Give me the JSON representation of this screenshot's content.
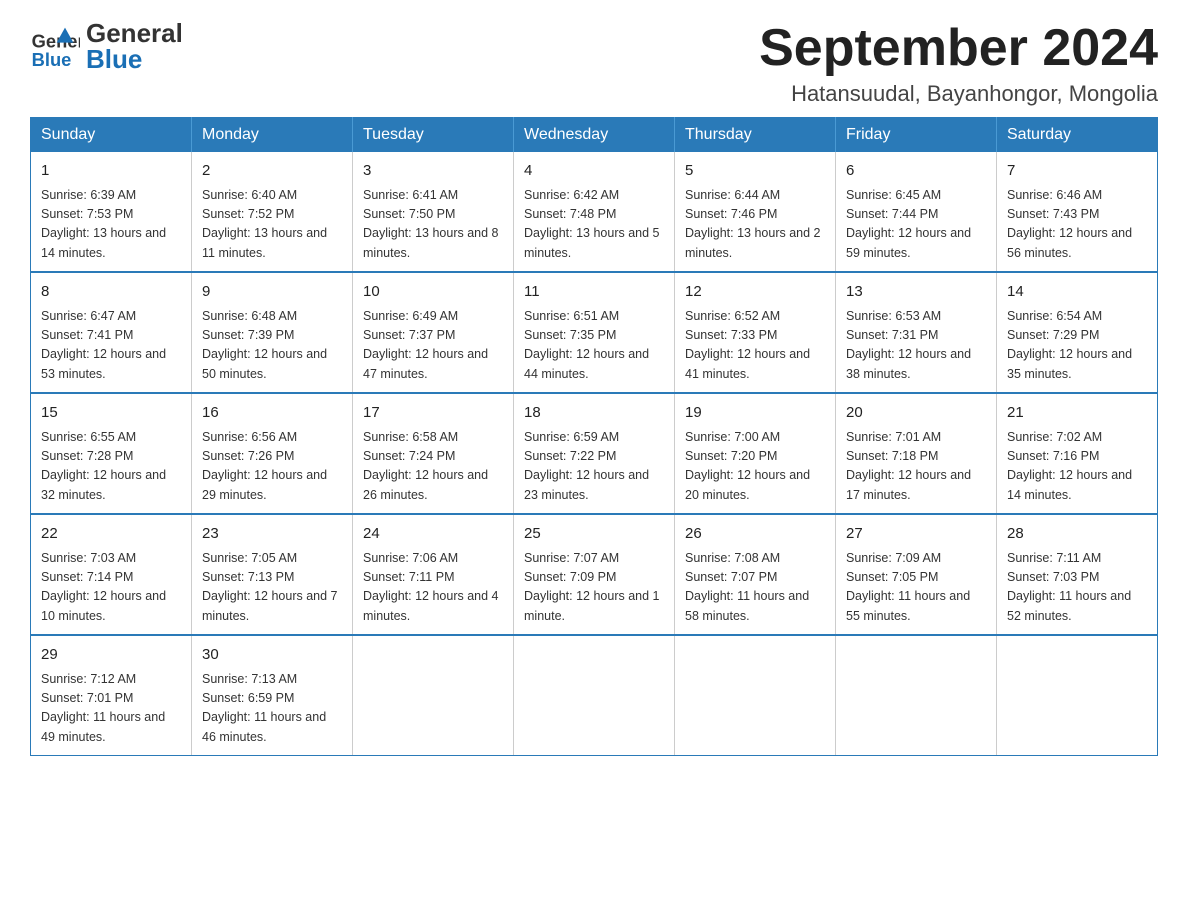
{
  "header": {
    "logo_general": "General",
    "logo_blue": "Blue",
    "month_title": "September 2024",
    "location": "Hatansuudal, Bayanhongor, Mongolia"
  },
  "days_of_week": [
    "Sunday",
    "Monday",
    "Tuesday",
    "Wednesday",
    "Thursday",
    "Friday",
    "Saturday"
  ],
  "weeks": [
    [
      {
        "day": "1",
        "sunrise": "Sunrise: 6:39 AM",
        "sunset": "Sunset: 7:53 PM",
        "daylight": "Daylight: 13 hours and 14 minutes."
      },
      {
        "day": "2",
        "sunrise": "Sunrise: 6:40 AM",
        "sunset": "Sunset: 7:52 PM",
        "daylight": "Daylight: 13 hours and 11 minutes."
      },
      {
        "day": "3",
        "sunrise": "Sunrise: 6:41 AM",
        "sunset": "Sunset: 7:50 PM",
        "daylight": "Daylight: 13 hours and 8 minutes."
      },
      {
        "day": "4",
        "sunrise": "Sunrise: 6:42 AM",
        "sunset": "Sunset: 7:48 PM",
        "daylight": "Daylight: 13 hours and 5 minutes."
      },
      {
        "day": "5",
        "sunrise": "Sunrise: 6:44 AM",
        "sunset": "Sunset: 7:46 PM",
        "daylight": "Daylight: 13 hours and 2 minutes."
      },
      {
        "day": "6",
        "sunrise": "Sunrise: 6:45 AM",
        "sunset": "Sunset: 7:44 PM",
        "daylight": "Daylight: 12 hours and 59 minutes."
      },
      {
        "day": "7",
        "sunrise": "Sunrise: 6:46 AM",
        "sunset": "Sunset: 7:43 PM",
        "daylight": "Daylight: 12 hours and 56 minutes."
      }
    ],
    [
      {
        "day": "8",
        "sunrise": "Sunrise: 6:47 AM",
        "sunset": "Sunset: 7:41 PM",
        "daylight": "Daylight: 12 hours and 53 minutes."
      },
      {
        "day": "9",
        "sunrise": "Sunrise: 6:48 AM",
        "sunset": "Sunset: 7:39 PM",
        "daylight": "Daylight: 12 hours and 50 minutes."
      },
      {
        "day": "10",
        "sunrise": "Sunrise: 6:49 AM",
        "sunset": "Sunset: 7:37 PM",
        "daylight": "Daylight: 12 hours and 47 minutes."
      },
      {
        "day": "11",
        "sunrise": "Sunrise: 6:51 AM",
        "sunset": "Sunset: 7:35 PM",
        "daylight": "Daylight: 12 hours and 44 minutes."
      },
      {
        "day": "12",
        "sunrise": "Sunrise: 6:52 AM",
        "sunset": "Sunset: 7:33 PM",
        "daylight": "Daylight: 12 hours and 41 minutes."
      },
      {
        "day": "13",
        "sunrise": "Sunrise: 6:53 AM",
        "sunset": "Sunset: 7:31 PM",
        "daylight": "Daylight: 12 hours and 38 minutes."
      },
      {
        "day": "14",
        "sunrise": "Sunrise: 6:54 AM",
        "sunset": "Sunset: 7:29 PM",
        "daylight": "Daylight: 12 hours and 35 minutes."
      }
    ],
    [
      {
        "day": "15",
        "sunrise": "Sunrise: 6:55 AM",
        "sunset": "Sunset: 7:28 PM",
        "daylight": "Daylight: 12 hours and 32 minutes."
      },
      {
        "day": "16",
        "sunrise": "Sunrise: 6:56 AM",
        "sunset": "Sunset: 7:26 PM",
        "daylight": "Daylight: 12 hours and 29 minutes."
      },
      {
        "day": "17",
        "sunrise": "Sunrise: 6:58 AM",
        "sunset": "Sunset: 7:24 PM",
        "daylight": "Daylight: 12 hours and 26 minutes."
      },
      {
        "day": "18",
        "sunrise": "Sunrise: 6:59 AM",
        "sunset": "Sunset: 7:22 PM",
        "daylight": "Daylight: 12 hours and 23 minutes."
      },
      {
        "day": "19",
        "sunrise": "Sunrise: 7:00 AM",
        "sunset": "Sunset: 7:20 PM",
        "daylight": "Daylight: 12 hours and 20 minutes."
      },
      {
        "day": "20",
        "sunrise": "Sunrise: 7:01 AM",
        "sunset": "Sunset: 7:18 PM",
        "daylight": "Daylight: 12 hours and 17 minutes."
      },
      {
        "day": "21",
        "sunrise": "Sunrise: 7:02 AM",
        "sunset": "Sunset: 7:16 PM",
        "daylight": "Daylight: 12 hours and 14 minutes."
      }
    ],
    [
      {
        "day": "22",
        "sunrise": "Sunrise: 7:03 AM",
        "sunset": "Sunset: 7:14 PM",
        "daylight": "Daylight: 12 hours and 10 minutes."
      },
      {
        "day": "23",
        "sunrise": "Sunrise: 7:05 AM",
        "sunset": "Sunset: 7:13 PM",
        "daylight": "Daylight: 12 hours and 7 minutes."
      },
      {
        "day": "24",
        "sunrise": "Sunrise: 7:06 AM",
        "sunset": "Sunset: 7:11 PM",
        "daylight": "Daylight: 12 hours and 4 minutes."
      },
      {
        "day": "25",
        "sunrise": "Sunrise: 7:07 AM",
        "sunset": "Sunset: 7:09 PM",
        "daylight": "Daylight: 12 hours and 1 minute."
      },
      {
        "day": "26",
        "sunrise": "Sunrise: 7:08 AM",
        "sunset": "Sunset: 7:07 PM",
        "daylight": "Daylight: 11 hours and 58 minutes."
      },
      {
        "day": "27",
        "sunrise": "Sunrise: 7:09 AM",
        "sunset": "Sunset: 7:05 PM",
        "daylight": "Daylight: 11 hours and 55 minutes."
      },
      {
        "day": "28",
        "sunrise": "Sunrise: 7:11 AM",
        "sunset": "Sunset: 7:03 PM",
        "daylight": "Daylight: 11 hours and 52 minutes."
      }
    ],
    [
      {
        "day": "29",
        "sunrise": "Sunrise: 7:12 AM",
        "sunset": "Sunset: 7:01 PM",
        "daylight": "Daylight: 11 hours and 49 minutes."
      },
      {
        "day": "30",
        "sunrise": "Sunrise: 7:13 AM",
        "sunset": "Sunset: 6:59 PM",
        "daylight": "Daylight: 11 hours and 46 minutes."
      },
      null,
      null,
      null,
      null,
      null
    ]
  ]
}
